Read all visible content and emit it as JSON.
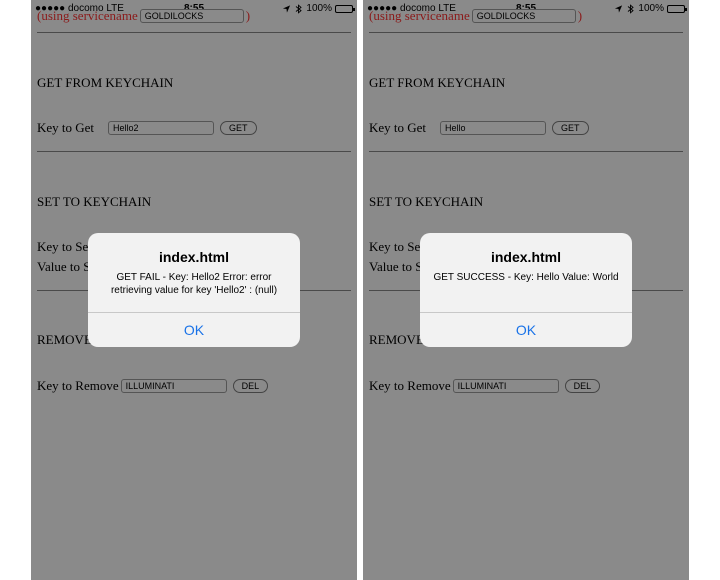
{
  "status": {
    "carrier": "●●●●● docomo  LTE",
    "time": "8:55",
    "battery": "100%",
    "battery_level": 1.0
  },
  "service": {
    "prefix": "(using servicename",
    "value": "GOLDILOCKS",
    "suffix": ")"
  },
  "get_section": {
    "title": "GET FROM KEYCHAIN",
    "key_label": "Key to Get",
    "button": "GET"
  },
  "set_section": {
    "title": "SET TO KEYCHAIN",
    "key_label_partial": "Key to Se",
    "value_label_partial": "Value to S"
  },
  "remove_section": {
    "title_partial": "REMOVE",
    "key_label": "Key to Remove",
    "key_value": "ILLUMINATI",
    "button": "DEL"
  },
  "phones": [
    {
      "get_key_value": "Hello2",
      "alert": {
        "title": "index.html",
        "message": "GET FAIL - Key: Hello2 Error: error retrieving value for key 'Hello2' : (null)",
        "ok": "OK"
      }
    },
    {
      "get_key_value": "Hello",
      "alert": {
        "title": "index.html",
        "message": "GET SUCCESS - Key: Hello Value: World",
        "ok": "OK"
      }
    }
  ],
  "colors": {
    "overlay": "#8a8a8a",
    "alert_bg": "#f2f2f2",
    "ok_blue": "#1a73e8",
    "service_red": "#8b1a1a"
  }
}
